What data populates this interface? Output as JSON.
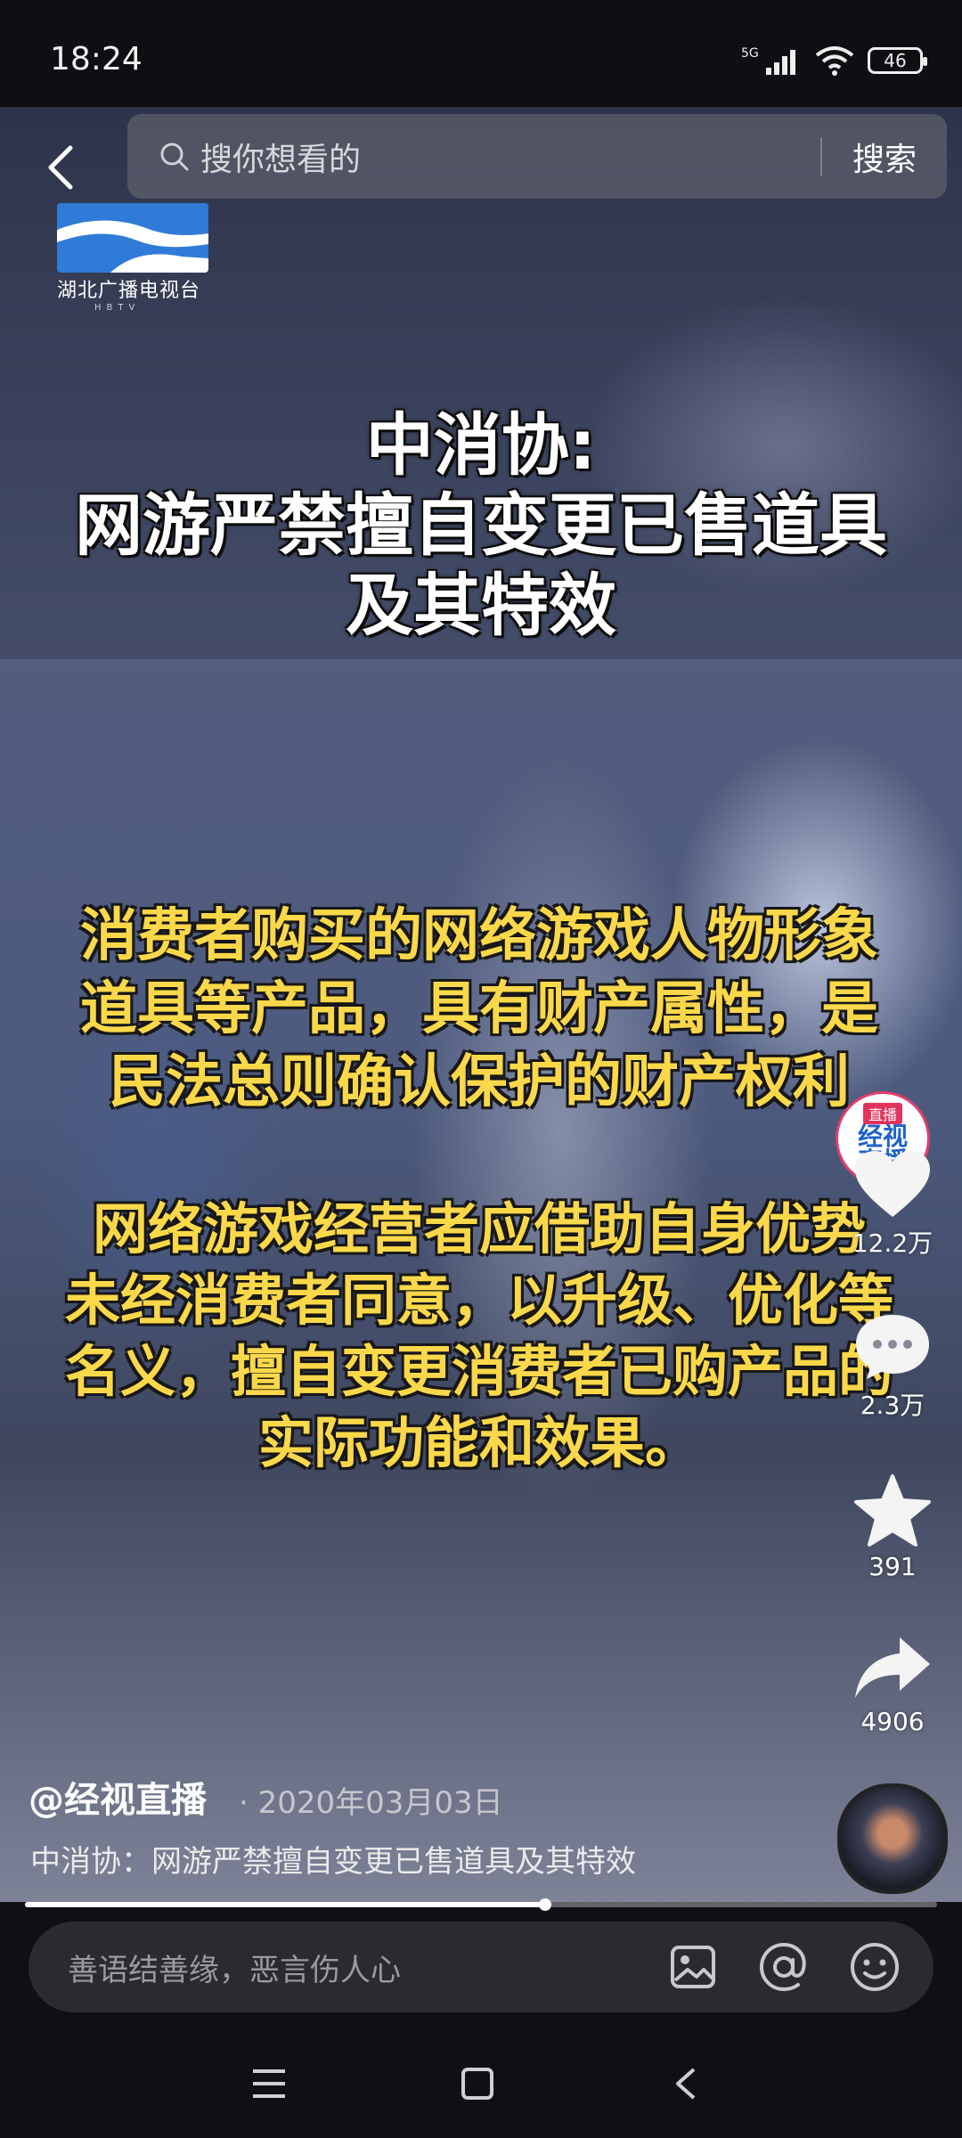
{
  "status_bar": {
    "time": "18:24",
    "network": "5G",
    "battery": "46"
  },
  "search": {
    "placeholder": "搜你想看的",
    "submit_label": "搜索"
  },
  "channel_logo": {
    "name": "湖北广播电视台",
    "sub": "HBTV"
  },
  "video_captions": {
    "title_lines": [
      "中消协:",
      "网游严禁擅自变更已售道具",
      "及其特效"
    ],
    "para1": [
      "消费者购买的网络游戏人物形象",
      "道具等产品，具有财产属性，是",
      "民法总则确认保护的财产权利"
    ],
    "para2": [
      "网络游戏经营者应借助自身优势",
      "未经消费者同意，以升级、优化等",
      "名义，擅自变更消费者已购产品的",
      "实际功能和效果。"
    ]
  },
  "creator_badge": {
    "line1": "直播",
    "line2": "经视",
    "line3": "直播"
  },
  "actions": {
    "likes": "12.2万",
    "comments": "2.3万",
    "favorites": "391",
    "shares": "4906"
  },
  "post": {
    "author": "@经视直播",
    "date": "· 2020年03月03日",
    "description": "中消协：网游严禁擅自变更已售道具及其特效"
  },
  "playback": {
    "progress": 0.57
  },
  "comment": {
    "placeholder": "善语结善缘，恶言伤人心"
  },
  "icons": {
    "back": "chevron-left-icon",
    "search": "search-icon",
    "like": "heart-icon",
    "comment": "comment-bubble-icon",
    "favorite": "star-icon",
    "share": "share-arrow-icon",
    "image": "image-icon",
    "mention": "at-icon",
    "emoji": "emoji-icon"
  },
  "colors": {
    "caption_yellow": "#fbd84a",
    "follow_red": "#f2294f"
  }
}
